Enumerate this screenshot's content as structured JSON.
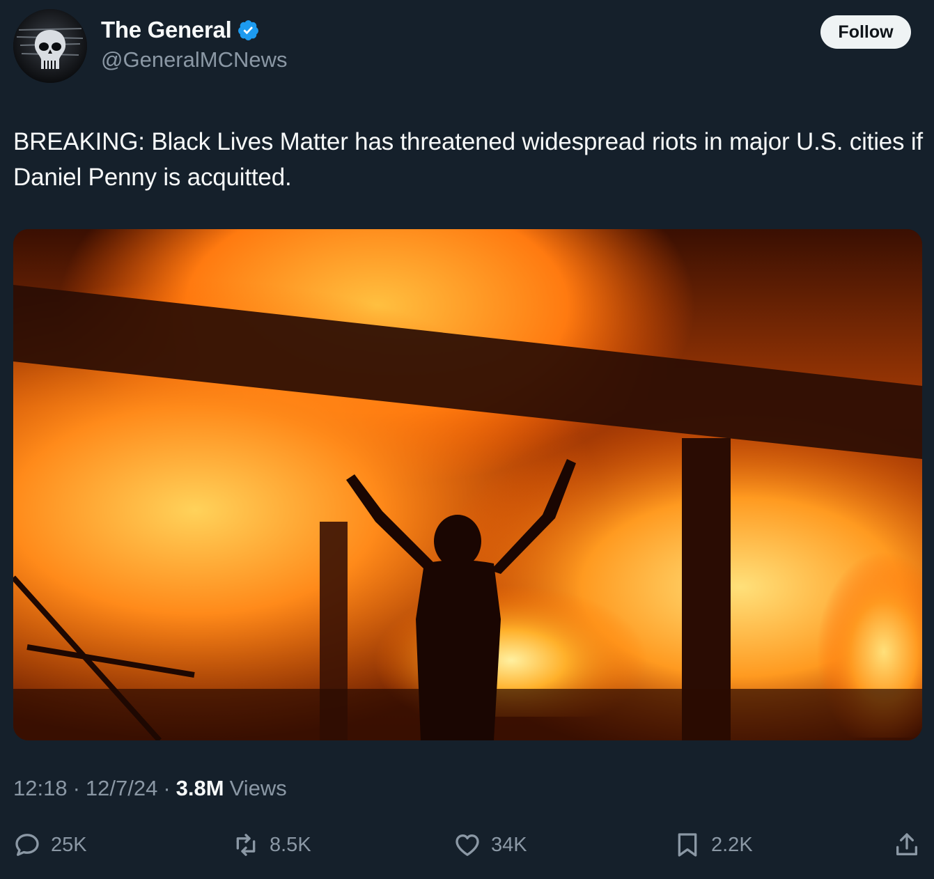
{
  "author": {
    "display_name": "The General",
    "handle": "@GeneralMCNews",
    "verified": true
  },
  "follow_label": "Follow",
  "tweet_text": "BREAKING: Black Lives Matter has threatened widespread riots in major U.S. cities if Daniel Penny is acquitted.",
  "meta": {
    "time": "12:18",
    "sep1": "·",
    "date": "12/7/24",
    "sep2": "·",
    "views_count": "3.8M",
    "views_label": "Views"
  },
  "actions": {
    "replies": "25K",
    "reposts": "8.5K",
    "likes": "34K",
    "bookmarks": "2.2K"
  },
  "colors": {
    "background": "#15202b",
    "text_primary": "#f7f9f9",
    "text_secondary": "#8b98a5",
    "verified_blue": "#1d9bf0",
    "follow_bg": "#eff3f4"
  },
  "icons": [
    "verified-badge-icon",
    "reply-icon",
    "repost-icon",
    "like-icon",
    "bookmark-icon",
    "share-icon"
  ]
}
